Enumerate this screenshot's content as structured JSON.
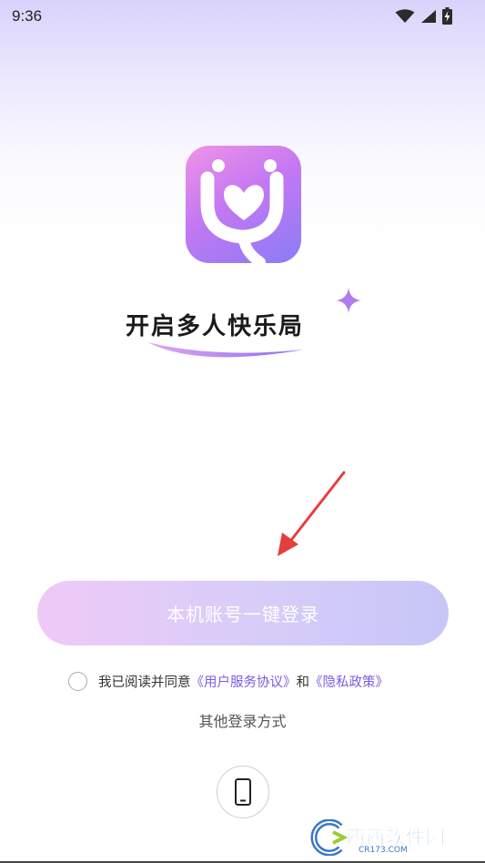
{
  "status_bar": {
    "time": "9:36",
    "icons": [
      "wifi-icon",
      "signal-icon",
      "battery-charging-icon"
    ]
  },
  "logo": {
    "icon": "app-logo-icon"
  },
  "slogan": {
    "text": "开启多人快乐局"
  },
  "login": {
    "one_tap_label": "本机账号一键登录"
  },
  "agreement": {
    "prefix": "我已阅读并同意",
    "user_agreement": "《用户服务协议》",
    "connector": "和",
    "privacy_policy": "《隐私政策》"
  },
  "other_login": {
    "label": "其他登录方式"
  },
  "phone_login": {
    "icon": "phone-icon"
  },
  "watermark": {
    "text": "西西软件园",
    "sub": "CR173.COM"
  },
  "colors": {
    "accent": "#7a5ce0",
    "button_start": "#efc9f7",
    "button_end": "#c6c6f7",
    "logo_pink": "#f092e8",
    "logo_purple": "#8a7cf7",
    "arrow_red": "#e53e3e"
  }
}
